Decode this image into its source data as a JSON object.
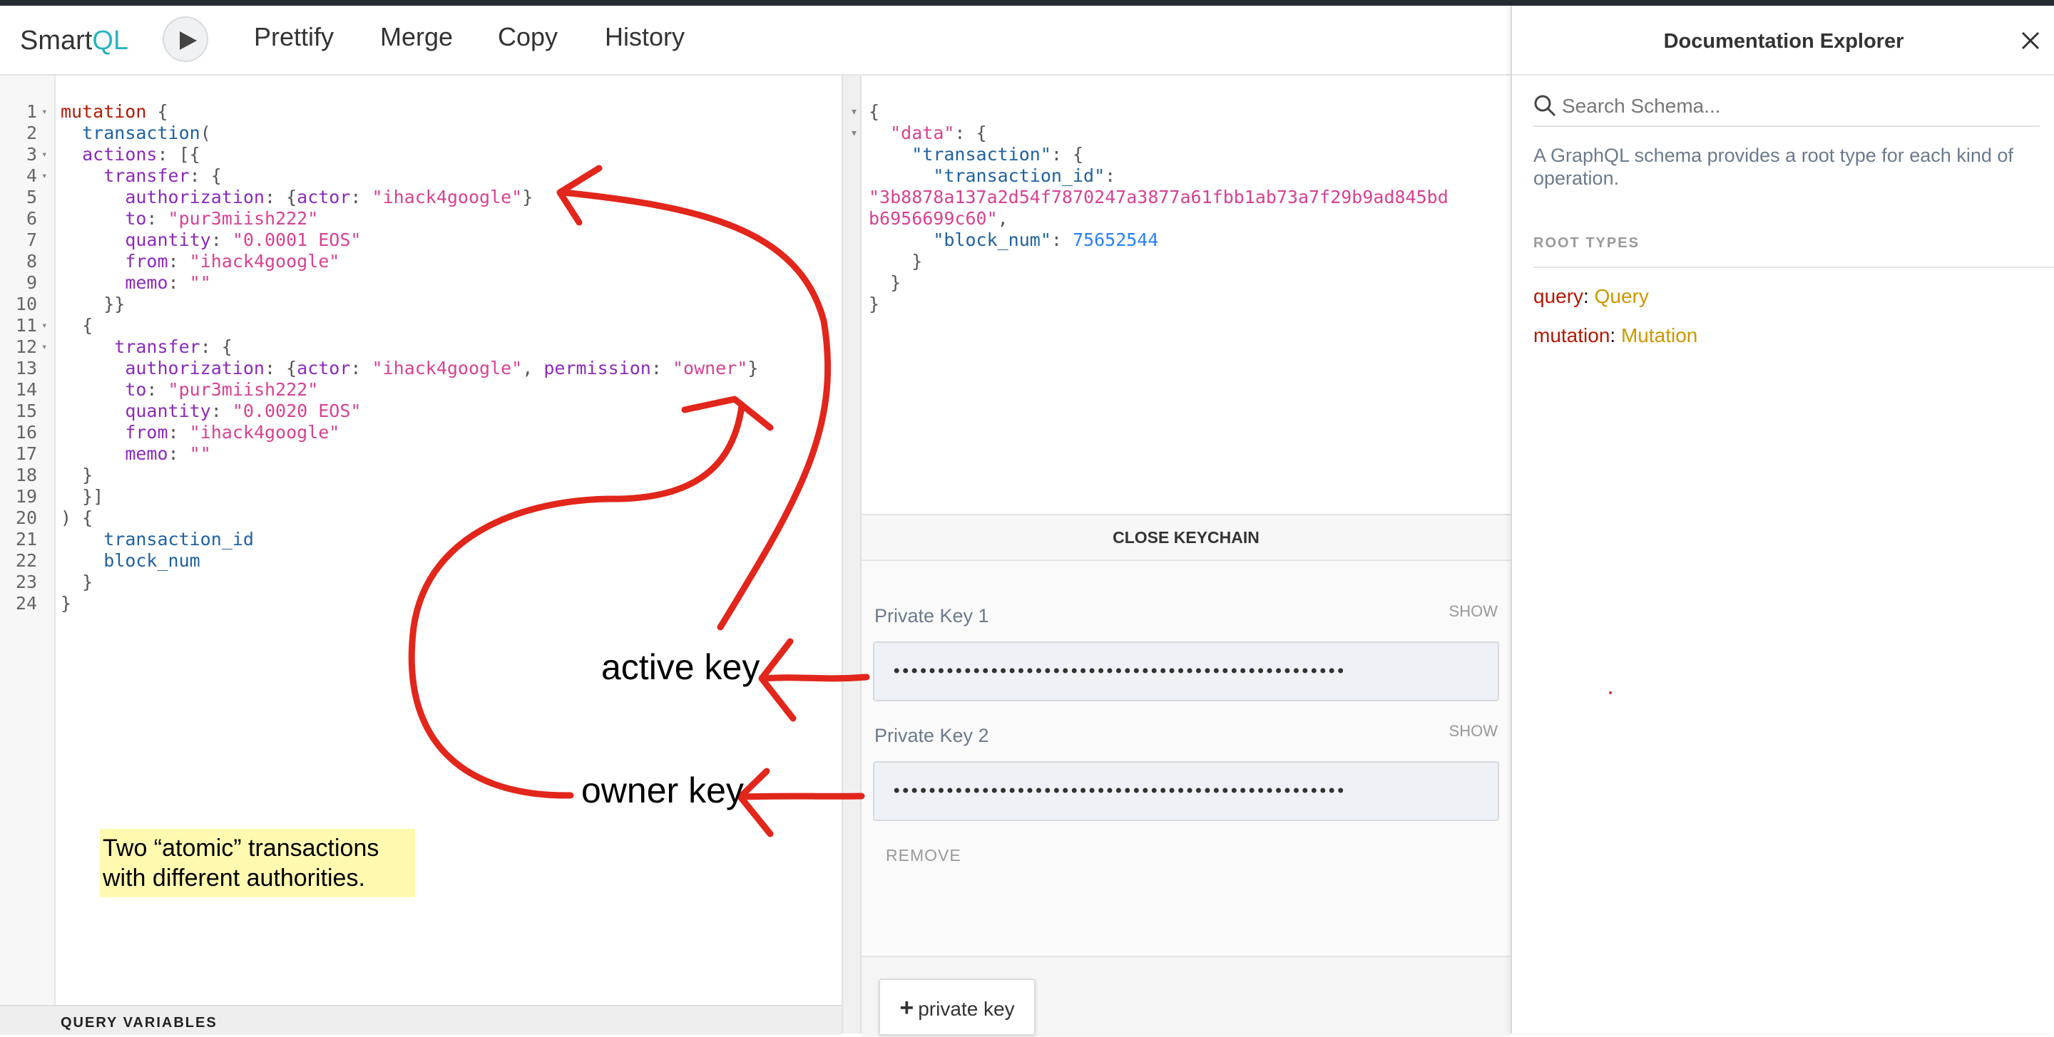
{
  "app": {
    "logo_prefix": "Smart",
    "logo_suffix": "QL",
    "run_button_label": "Run",
    "toolbar": [
      "Prettify",
      "Merge",
      "Copy",
      "History"
    ]
  },
  "editor": {
    "lines": [
      {
        "n": "1",
        "fold": true,
        "tokens": [
          [
            "kw",
            "mutation"
          ],
          [
            "pun",
            " {"
          ]
        ]
      },
      {
        "n": "2",
        "fold": false,
        "tokens": [
          [
            "pun",
            "  "
          ],
          [
            "def",
            "transaction"
          ],
          [
            "pun",
            "("
          ]
        ]
      },
      {
        "n": "3",
        "fold": true,
        "tokens": [
          [
            "pun",
            "  "
          ],
          [
            "attr",
            "actions"
          ],
          [
            "pun",
            ": [{"
          ]
        ]
      },
      {
        "n": "4",
        "fold": true,
        "tokens": [
          [
            "pun",
            "    "
          ],
          [
            "attr",
            "transfer"
          ],
          [
            "pun",
            ": {"
          ]
        ]
      },
      {
        "n": "5",
        "fold": false,
        "tokens": [
          [
            "pun",
            "      "
          ],
          [
            "attr",
            "authorization"
          ],
          [
            "pun",
            ": {"
          ],
          [
            "attr",
            "actor"
          ],
          [
            "pun",
            ": "
          ],
          [
            "str",
            "\"ihack4google\""
          ],
          [
            "pun",
            "}"
          ]
        ]
      },
      {
        "n": "6",
        "fold": false,
        "tokens": [
          [
            "pun",
            "      "
          ],
          [
            "attr",
            "to"
          ],
          [
            "pun",
            ": "
          ],
          [
            "str",
            "\"pur3miish222\""
          ]
        ]
      },
      {
        "n": "7",
        "fold": false,
        "tokens": [
          [
            "pun",
            "      "
          ],
          [
            "attr",
            "quantity"
          ],
          [
            "pun",
            ": "
          ],
          [
            "str",
            "\"0.0001 EOS\""
          ]
        ]
      },
      {
        "n": "8",
        "fold": false,
        "tokens": [
          [
            "pun",
            "      "
          ],
          [
            "attr",
            "from"
          ],
          [
            "pun",
            ": "
          ],
          [
            "str",
            "\"ihack4google\""
          ]
        ]
      },
      {
        "n": "9",
        "fold": false,
        "tokens": [
          [
            "pun",
            "      "
          ],
          [
            "attr",
            "memo"
          ],
          [
            "pun",
            ": "
          ],
          [
            "str",
            "\"\""
          ]
        ]
      },
      {
        "n": "10",
        "fold": false,
        "tokens": [
          [
            "pun",
            "    }}"
          ]
        ]
      },
      {
        "n": "11",
        "fold": true,
        "tokens": [
          [
            "pun",
            "  {"
          ]
        ]
      },
      {
        "n": "12",
        "fold": true,
        "tokens": [
          [
            "pun",
            "     "
          ],
          [
            "attr",
            "transfer"
          ],
          [
            "pun",
            ": {"
          ]
        ]
      },
      {
        "n": "13",
        "fold": false,
        "tokens": [
          [
            "pun",
            "      "
          ],
          [
            "attr",
            "authorization"
          ],
          [
            "pun",
            ": {"
          ],
          [
            "attr",
            "actor"
          ],
          [
            "pun",
            ": "
          ],
          [
            "str",
            "\"ihack4google\""
          ],
          [
            "pun",
            ", "
          ],
          [
            "attr",
            "permission"
          ],
          [
            "pun",
            ": "
          ],
          [
            "str",
            "\"owner\""
          ],
          [
            "pun",
            "}"
          ]
        ]
      },
      {
        "n": "14",
        "fold": false,
        "tokens": [
          [
            "pun",
            "      "
          ],
          [
            "attr",
            "to"
          ],
          [
            "pun",
            ": "
          ],
          [
            "str",
            "\"pur3miish222\""
          ]
        ]
      },
      {
        "n": "15",
        "fold": false,
        "tokens": [
          [
            "pun",
            "      "
          ],
          [
            "attr",
            "quantity"
          ],
          [
            "pun",
            ": "
          ],
          [
            "str",
            "\"0.0020 EOS\""
          ]
        ]
      },
      {
        "n": "16",
        "fold": false,
        "tokens": [
          [
            "pun",
            "      "
          ],
          [
            "attr",
            "from"
          ],
          [
            "pun",
            ": "
          ],
          [
            "str",
            "\"ihack4google\""
          ]
        ]
      },
      {
        "n": "17",
        "fold": false,
        "tokens": [
          [
            "pun",
            "      "
          ],
          [
            "attr",
            "memo"
          ],
          [
            "pun",
            ": "
          ],
          [
            "str",
            "\"\""
          ]
        ]
      },
      {
        "n": "18",
        "fold": false,
        "tokens": [
          [
            "pun",
            "  }"
          ]
        ]
      },
      {
        "n": "19",
        "fold": false,
        "tokens": [
          [
            "pun",
            "  }]"
          ]
        ]
      },
      {
        "n": "20",
        "fold": false,
        "tokens": [
          [
            "pun",
            ") {"
          ]
        ]
      },
      {
        "n": "21",
        "fold": false,
        "tokens": [
          [
            "pun",
            "    "
          ],
          [
            "def",
            "transaction_id"
          ]
        ]
      },
      {
        "n": "22",
        "fold": false,
        "tokens": [
          [
            "pun",
            "    "
          ],
          [
            "def",
            "block_num"
          ]
        ]
      },
      {
        "n": "23",
        "fold": false,
        "tokens": [
          [
            "pun",
            "  }"
          ]
        ]
      },
      {
        "n": "24",
        "fold": false,
        "tokens": [
          [
            "pun",
            "}"
          ]
        ]
      }
    ],
    "query_variables_label": "QUERY VARIABLES"
  },
  "result": {
    "lines": [
      {
        "fold": true,
        "tokens": [
          [
            "pun",
            "{"
          ]
        ]
      },
      {
        "fold": true,
        "tokens": [
          [
            "pun",
            "  "
          ],
          [
            "str",
            "\"data\""
          ],
          [
            "pun",
            ": {"
          ]
        ]
      },
      {
        "fold": false,
        "tokens": [
          [
            "pun",
            "    "
          ],
          [
            "def",
            "\"transaction\""
          ],
          [
            "pun",
            ": {"
          ]
        ]
      },
      {
        "fold": false,
        "tokens": [
          [
            "pun",
            "      "
          ],
          [
            "def",
            "\"transaction_id\""
          ],
          [
            "pun",
            ":"
          ]
        ]
      },
      {
        "fold": false,
        "tokens": [
          [
            "str",
            "\"3b8878a137a2d54f7870247a3877a61fbb1ab73a7f29b9ad845bd"
          ]
        ]
      },
      {
        "fold": false,
        "tokens": [
          [
            "str",
            "b6956699c60\""
          ],
          [
            "pun",
            ","
          ]
        ]
      },
      {
        "fold": false,
        "tokens": [
          [
            "pun",
            "      "
          ],
          [
            "def",
            "\"block_num\""
          ],
          [
            "pun",
            ": "
          ],
          [
            "num",
            "75652544"
          ]
        ]
      },
      {
        "fold": false,
        "tokens": [
          [
            "pun",
            "    }"
          ]
        ]
      },
      {
        "fold": false,
        "tokens": [
          [
            "pun",
            "  }"
          ]
        ]
      },
      {
        "fold": false,
        "tokens": [
          [
            "pun",
            "}"
          ]
        ]
      }
    ]
  },
  "keychain": {
    "close_label": "CLOSE KEYCHAIN",
    "keys": [
      {
        "label": "Private Key 1",
        "show": "SHOW",
        "value": "•••••••••••••••••••••••••••••••••••••••••••••••••••"
      },
      {
        "label": "Private Key 2",
        "show": "SHOW",
        "value": "•••••••••••••••••••••••••••••••••••••••••••••••••••"
      }
    ],
    "remove_label": "REMOVE",
    "add_key_icon": "+",
    "add_key_label": "private key"
  },
  "docs": {
    "title": "Documentation Explorer",
    "search_placeholder": "Search Schema...",
    "description": "A GraphQL schema provides a root type for each kind of operation.",
    "root_types_heading": "ROOT TYPES",
    "root_types": [
      {
        "field": "query",
        "type": "Query"
      },
      {
        "field": "mutation",
        "type": "Mutation"
      }
    ]
  },
  "annotations": {
    "active_key": "active key",
    "owner_key": "owner key",
    "note_line1": "Two “atomic” transactions",
    "note_line2": "with different authorities.",
    "arrow_color": "#e2261b"
  },
  "colors": {
    "keyword": "#b11a04",
    "definition": "#1f61a0",
    "attribute": "#8b2bb9",
    "string": "#d64292",
    "number": "#2882f9",
    "type_name": "#ca9800",
    "logo_accent": "#2bb3c0"
  }
}
